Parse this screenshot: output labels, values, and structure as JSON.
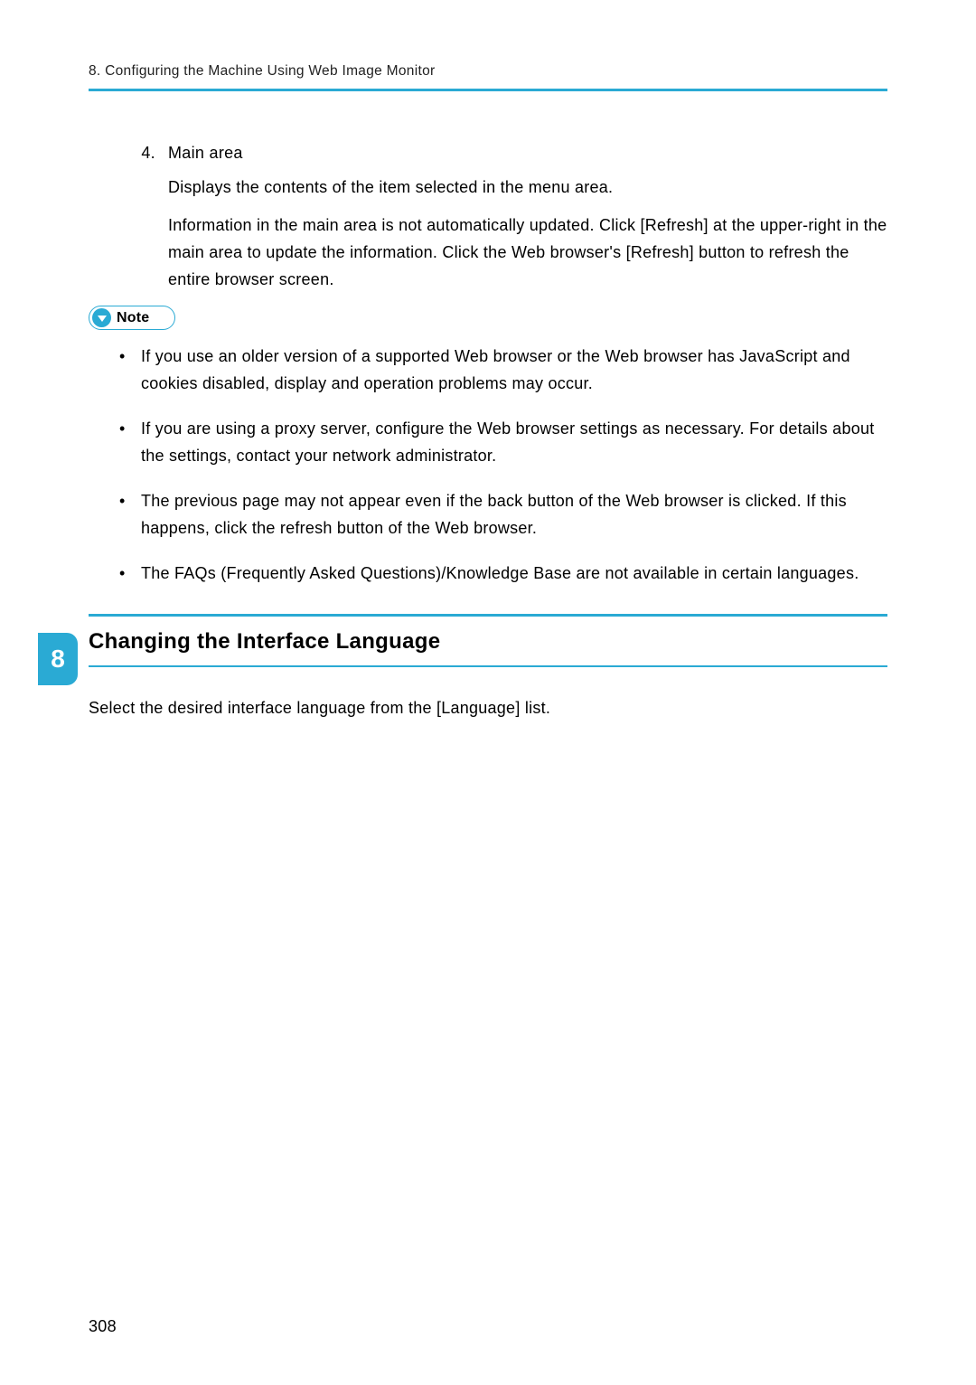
{
  "running_head": "8. Configuring the Machine Using Web Image Monitor",
  "item4": {
    "number": "4.",
    "title": "Main area",
    "p1": "Displays the contents of the item selected in the menu area.",
    "p2": "Information in the main area is not automatically updated. Click [Refresh] at the upper-right in the main area to update the information. Click the Web browser's [Refresh] button to refresh the entire browser screen."
  },
  "note_label": "Note",
  "notes": {
    "n1": "If you use an older version of a supported Web browser or the Web browser has JavaScript and cookies disabled, display and operation problems may occur.",
    "n2": "If you are using a proxy server, configure the Web browser settings as necessary. For details about the settings, contact your network administrator.",
    "n3": "The previous page may not appear even if the back button of the Web browser is clicked. If this happens, click the refresh button of the Web browser.",
    "n4": "The FAQs (Frequently Asked Questions)/Knowledge Base are not available in certain languages."
  },
  "section": {
    "title": "Changing the Interface Language",
    "body": "Select the desired interface language from the [Language] list."
  },
  "side_tab": "8",
  "page_number": "308"
}
